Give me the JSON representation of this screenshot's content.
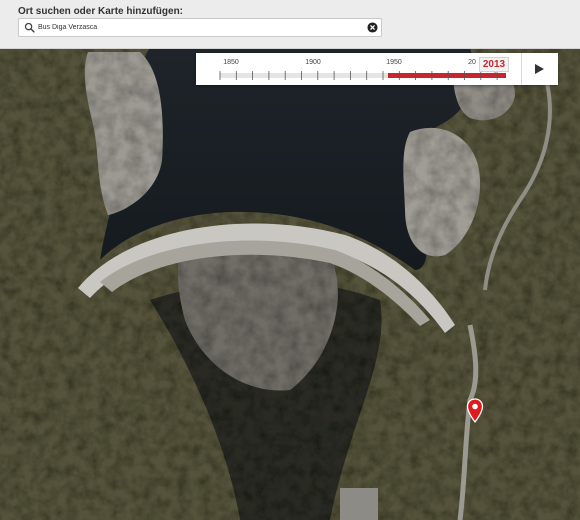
{
  "search": {
    "title": "Ort suchen oder Karte hinzufügen:",
    "value": "Bus Diga Verzasca",
    "icon": "search-icon",
    "clear_icon": "clear-icon"
  },
  "timeline": {
    "year_labels": [
      "1850",
      "1900",
      "1950",
      "20"
    ],
    "current_year": "2013",
    "accent_color": "#c8262c",
    "play_icon": "play-icon"
  },
  "map": {
    "type": "satellite",
    "marker_icon": "location-pin-icon",
    "marker_color": "#e0191f"
  }
}
